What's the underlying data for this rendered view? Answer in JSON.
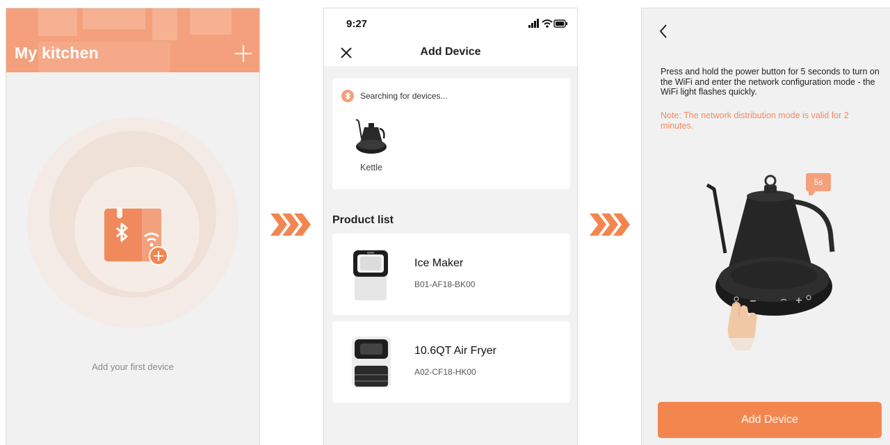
{
  "screen1": {
    "title": "My kitchen",
    "add_icon": "plus-icon",
    "device_icon": "bluetooth-device-add-icon",
    "empty_text": "Add your first device"
  },
  "screen2": {
    "status_time": "9:27",
    "close_icon": "close-icon",
    "title": "Add Device",
    "searching_text": "Searching for devices...",
    "found_device": {
      "label": "Kettle"
    },
    "product_list_title": "Product list",
    "products": [
      {
        "name": "Ice Maker",
        "model": "B01-AF18-BK00"
      },
      {
        "name": "10.6QT Air Fryer",
        "model": "A02-CF18-HK00"
      }
    ]
  },
  "screen3": {
    "back_icon": "chevron-left-icon",
    "instruction": "Press and hold the power button for 5 seconds to turn on the WiFi and enter the network configuration mode - the WiFi light flashes quickly.",
    "note": "Note: The network distribution mode is valid for 2 minutes.",
    "badge": "5s",
    "button_label": "Add Device"
  },
  "colors": {
    "accent": "#f3864f",
    "header": "#f4a07c",
    "note": "#f28b5f",
    "background": "#f1f1f1"
  }
}
